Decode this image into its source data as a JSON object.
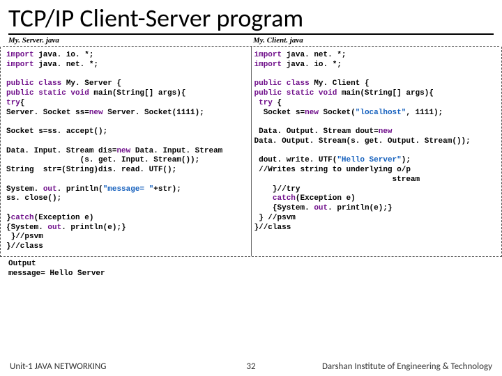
{
  "title": "TCP/IP Client-Server program",
  "left_header": "My. Server. java",
  "right_header": "My. Client. java",
  "server_code": {
    "l1a": "import",
    "l1b": " java. io. *;",
    "l2a": "import",
    "l2b": " java. net. *;",
    "blank1": "",
    "l3a": "public class ",
    "l3b": "My. Server {",
    "l4a": "public static void ",
    "l4b": "main(String[] args){",
    "l5a": "try",
    "l5b": "{",
    "l6a": "Server. Socket ss=",
    "l6b": "new",
    "l6c": " Server. Socket(1111);",
    "blank2": "",
    "l7": "Socket s=ss. accept();",
    "blank3": "",
    "l8a": "Data. Input. Stream dis=",
    "l8b": "new",
    "l8c": " Data. Input. Stream",
    "l9": "                (s. get. Input. Stream());",
    "l10": "String  str=(String)dis. read. UTF();",
    "blank4": "",
    "l11a": "System. ",
    "l11b": "out",
    "l11c": ". println(",
    "l11d": "\"message= \"",
    "l11e": "+str);",
    "l12": "ss. close();",
    "blank5": "",
    "l13a": "}",
    "l13b": "catch",
    "l13c": "(Exception e)",
    "l14a": "{System. ",
    "l14b": "out",
    "l14c": ". println(e);}",
    "l15": " }//psvm",
    "l16": "}//class"
  },
  "client_code": {
    "l1a": "import",
    "l1b": " java. net. *;",
    "l2a": "import",
    "l2b": " java. io. *;",
    "blank1": "",
    "l3a": "public class ",
    "l3b": "My. Client {",
    "l4a": "public static void ",
    "l4b": "main(String[] args){",
    "l5a": " try ",
    "l5b": "{",
    "l6a": "  Socket s=",
    "l6b": "new",
    "l6c": " Socket(",
    "l6d": "\"localhost\"",
    "l6e": ", 1111);",
    "blank2": "",
    "l7a": " Data. Output. Stream dout=",
    "l7b": "new",
    "l8": "Data. Output. Stream(s. get. Output. Stream());",
    "blank3": "",
    "l9a": " dout. write. UTF(",
    "l9b": "\"Hello Server\"",
    "l9c": ");",
    "l10": " //Writes string to underlying o/p",
    "l11": "                              stream",
    "l12": "    }//try",
    "l13a": "    ",
    "l13b": "catch",
    "l13c": "(Exception e)",
    "l14a": "    {System. ",
    "l14b": "out",
    "l14c": ". println(e);}",
    "l15": " } //psvm",
    "l16": "}//class"
  },
  "output": {
    "label": "Output",
    "line": "message= Hello Server"
  },
  "footer": {
    "left": "Unit-1 JAVA NETWORKING",
    "center": "32",
    "right": "Darshan Institute of Engineering & Technology"
  }
}
